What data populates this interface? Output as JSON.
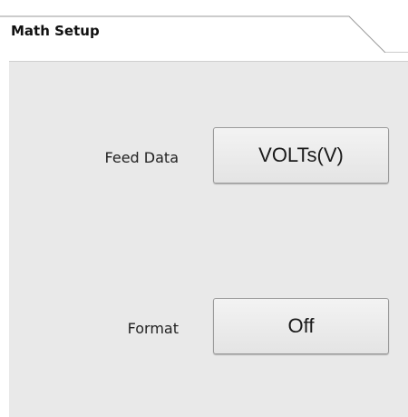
{
  "tab": {
    "title": "Math Setup"
  },
  "settings": [
    {
      "label": "Feed Data",
      "value": "VOLTs(V)"
    },
    {
      "label": "Format",
      "value": "Off"
    }
  ]
}
